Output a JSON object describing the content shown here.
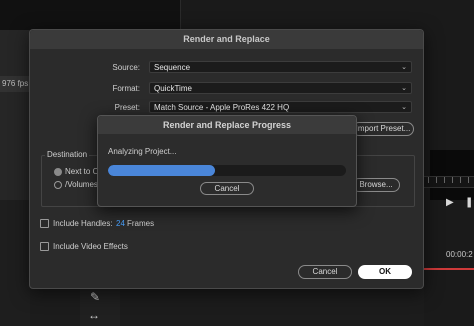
{
  "background": {
    "fps_text": "976 fps",
    "timecode": "00:00:2"
  },
  "render_dialog": {
    "title": "Render and Replace",
    "source": {
      "label": "Source:",
      "value": "Sequence"
    },
    "format": {
      "label": "Format:",
      "value": "QuickTime"
    },
    "preset": {
      "label": "Preset:",
      "value": "Match Source - Apple ProRes 422 HQ"
    },
    "import_preset_label": "Import Preset...",
    "destination": {
      "label": "Destination",
      "option1": "Next to O",
      "option2": "/Volumes",
      "browse_label": "Browse..."
    },
    "include_handles": {
      "label": "Include Handles:",
      "frames_value": "24",
      "frames_unit": "Frames"
    },
    "include_video_effects": {
      "label": "Include Video Effects"
    },
    "cancel_label": "Cancel",
    "ok_label": "OK"
  },
  "progress_dialog": {
    "title": "Render and Replace Progress",
    "status": "Analyzing Project...",
    "progress_fraction": 0.45,
    "cancel_label": "Cancel"
  },
  "colors": {
    "accent": "#4a86d9",
    "frames_value": "#4aa3ff",
    "timeline_marker": "#cf3a3a"
  }
}
